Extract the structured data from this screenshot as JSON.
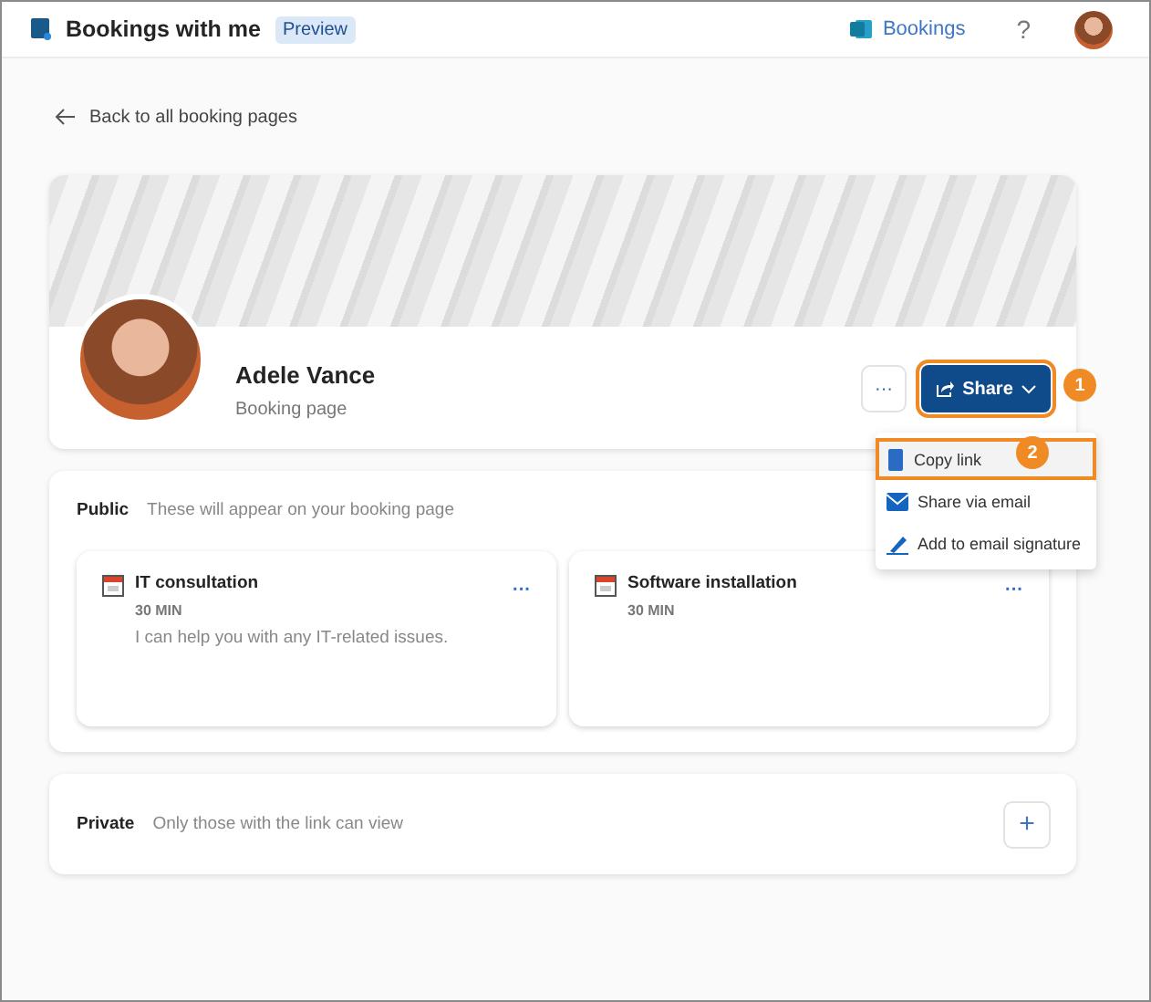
{
  "header": {
    "title": "Bookings with me",
    "badge": "Preview",
    "app_link": "Bookings",
    "help": "?"
  },
  "back_link": "Back to all booking pages",
  "profile": {
    "name": "Adele Vance",
    "subtitle": "Booking page",
    "more": "···",
    "share_button": {
      "label": "Share",
      "step": "1",
      "highlighted": true
    }
  },
  "share_menu": {
    "items": [
      {
        "kind": "copy",
        "label": "Copy link",
        "selected": true,
        "step": "2"
      },
      {
        "kind": "email",
        "label": "Share via email",
        "selected": false
      },
      {
        "kind": "signature",
        "label": "Add to email signature",
        "selected": false
      }
    ]
  },
  "public": {
    "label": "Public",
    "description": "These will appear on your booking page",
    "services": [
      {
        "title": "IT consultation",
        "duration": "30 MIN",
        "description": "I can help you with any IT-related issues.",
        "more": "···"
      },
      {
        "title": "Software installation",
        "duration": "30 MIN",
        "more": "···"
      }
    ]
  },
  "private": {
    "label": "Private",
    "description": "Only those with the link can view",
    "add": "+"
  }
}
